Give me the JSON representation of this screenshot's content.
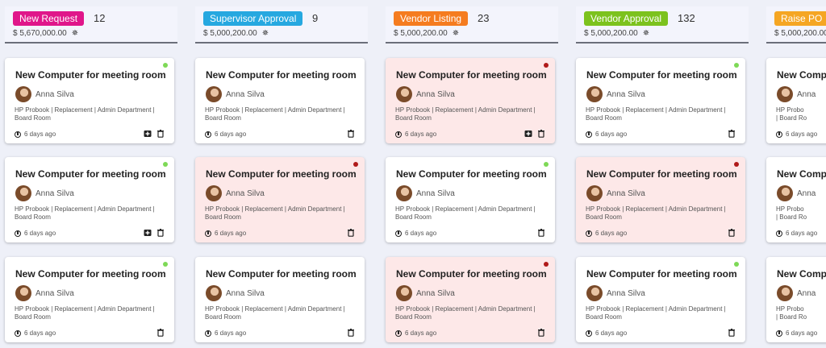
{
  "columns": [
    {
      "tag": "New Request",
      "color": "#e0168a",
      "count": "12",
      "amount": "$ 5,670,000.00"
    },
    {
      "tag": "Supervisor Approval",
      "color": "#26a8e0",
      "count": "9",
      "amount": "$ 5,000,200.00"
    },
    {
      "tag": "Vendor Listing",
      "color": "#f57c1f",
      "count": "23",
      "amount": "$ 5,000,200.00"
    },
    {
      "tag": "Vendor Approval",
      "color": "#7cc21d",
      "count": "132",
      "amount": "$ 5,000,200.00"
    },
    {
      "tag": "Raise PO",
      "color": "#f5a623",
      "count": "",
      "amount": "$ 5,000,200.00"
    }
  ],
  "card": {
    "title": "New Computer for meeting room",
    "name": "Anna Silva",
    "desc": "HP Probook | Replacement | Admin Department | Board Room",
    "time": "6 days ago"
  },
  "card_title_partial": "New Comp",
  "card_name_partial": "Anna",
  "card_desc_partial": "HP Probo\n| Board Ro",
  "icons": {
    "settings": "gear-icon",
    "clock": "clock-icon",
    "add": "add-box-icon",
    "delete": "trash-icon"
  },
  "grid": [
    [
      {
        "status": "green",
        "alert": false,
        "add": true
      },
      {
        "status": "green",
        "alert": false,
        "add": true
      },
      {
        "status": "green",
        "alert": false,
        "add": false
      }
    ],
    [
      {
        "status": "none",
        "alert": false,
        "add": false
      },
      {
        "status": "red",
        "alert": true,
        "add": false
      },
      {
        "status": "none",
        "alert": false,
        "add": false
      }
    ],
    [
      {
        "status": "red",
        "alert": true,
        "add": true
      },
      {
        "status": "green",
        "alert": false,
        "add": false
      },
      {
        "status": "red",
        "alert": true,
        "add": false
      }
    ],
    [
      {
        "status": "green",
        "alert": false,
        "add": false
      },
      {
        "status": "red",
        "alert": true,
        "add": false
      },
      {
        "status": "green",
        "alert": false,
        "add": false
      }
    ],
    [
      {
        "status": "none",
        "alert": false,
        "add": false
      },
      {
        "status": "none",
        "alert": false,
        "add": false
      },
      {
        "status": "none",
        "alert": false,
        "add": false
      }
    ]
  ]
}
